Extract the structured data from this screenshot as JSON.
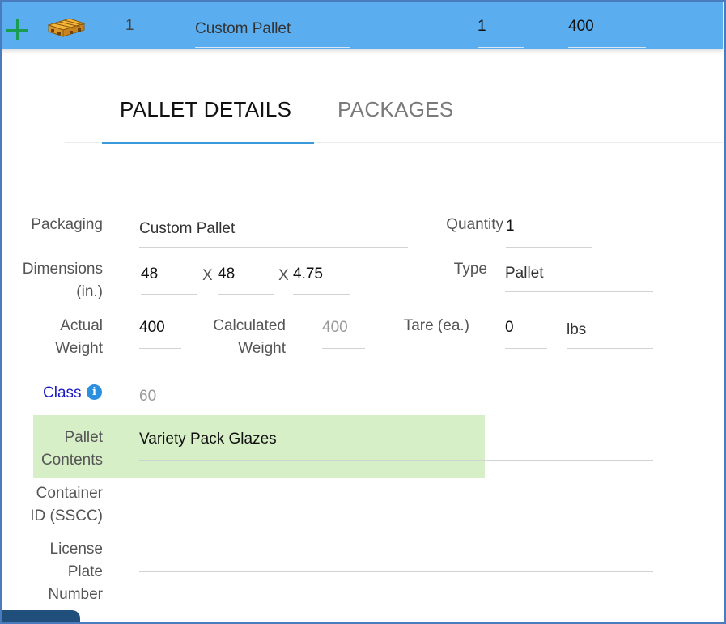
{
  "header": {
    "line_number": "1",
    "packaging": "Custom Pallet",
    "quantity": "1",
    "weight": "400"
  },
  "tabs": [
    {
      "label": "PALLET DETAILS",
      "active": true
    },
    {
      "label": "PACKAGES",
      "active": false
    }
  ],
  "form": {
    "packaging": {
      "label": "Packaging",
      "value": "Custom Pallet"
    },
    "quantity": {
      "label": "Quantity",
      "value": "1"
    },
    "dimensions": {
      "label_line1": "Dimensions",
      "label_line2": "(in.)",
      "length": "48",
      "width": "48",
      "height": "4.75",
      "separator": "X"
    },
    "type": {
      "label": "Type",
      "value": "Pallet"
    },
    "actual_weight": {
      "label_line1": "Actual",
      "label_line2": "Weight",
      "value": "400"
    },
    "calculated_weight": {
      "label_line1": "Calculated",
      "label_line2": "Weight",
      "value": "400"
    },
    "tare": {
      "label": "Tare (ea.)",
      "value": "0",
      "unit": "lbs"
    },
    "class": {
      "label": "Class",
      "info": "i",
      "value": "60"
    },
    "pallet_contents": {
      "label_line1": "Pallet",
      "label_line2": "Contents",
      "value": "Variety Pack Glazes"
    },
    "container_id": {
      "label_line1": "Container",
      "label_line2": "ID (SSCC)",
      "value": ""
    },
    "license_plate": {
      "label_line1": "License",
      "label_line2": "Plate",
      "label_line3": "Number",
      "value": ""
    }
  },
  "colors": {
    "header_bg": "#5aaef0",
    "tab_accent": "#3a9ad9",
    "highlight": "#d7efc6",
    "add_icon": "#1a9c53",
    "link": "#1a1ac4"
  }
}
